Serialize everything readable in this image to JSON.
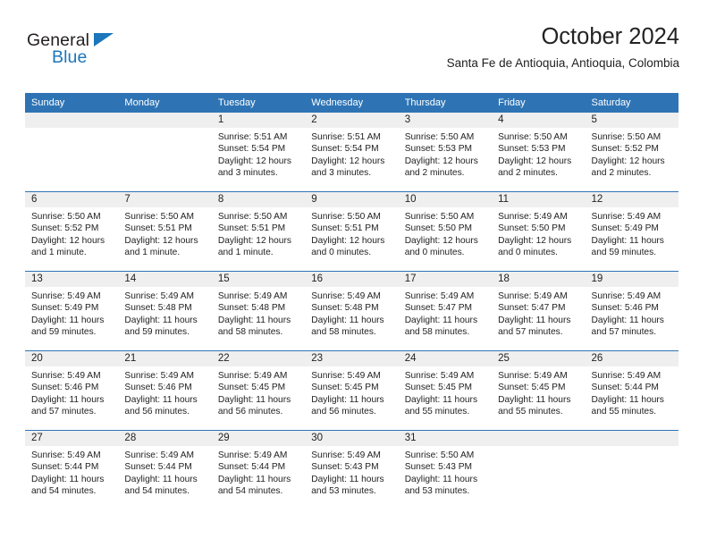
{
  "logo": {
    "word_top": "General",
    "word_bottom": "Blue",
    "triangle_color": "#1b76bc",
    "text_color": "#231f20"
  },
  "header": {
    "month_title": "October 2024",
    "location": "Santa Fe de Antioquia, Antioquia, Colombia",
    "accent_color": "#2e74b5"
  },
  "calendar": {
    "weekday_headers": [
      "Sunday",
      "Monday",
      "Tuesday",
      "Wednesday",
      "Thursday",
      "Friday",
      "Saturday"
    ],
    "header_bg": "#2e74b5",
    "header_text_color": "#ffffff",
    "daynum_bg": "#efefef",
    "weeks": [
      [
        {
          "day": "",
          "sunrise": "",
          "sunset": "",
          "daylight_line1": "",
          "daylight_line2": ""
        },
        {
          "day": "",
          "sunrise": "",
          "sunset": "",
          "daylight_line1": "",
          "daylight_line2": ""
        },
        {
          "day": "1",
          "sunrise": "Sunrise: 5:51 AM",
          "sunset": "Sunset: 5:54 PM",
          "daylight_line1": "Daylight: 12 hours",
          "daylight_line2": "and 3 minutes."
        },
        {
          "day": "2",
          "sunrise": "Sunrise: 5:51 AM",
          "sunset": "Sunset: 5:54 PM",
          "daylight_line1": "Daylight: 12 hours",
          "daylight_line2": "and 3 minutes."
        },
        {
          "day": "3",
          "sunrise": "Sunrise: 5:50 AM",
          "sunset": "Sunset: 5:53 PM",
          "daylight_line1": "Daylight: 12 hours",
          "daylight_line2": "and 2 minutes."
        },
        {
          "day": "4",
          "sunrise": "Sunrise: 5:50 AM",
          "sunset": "Sunset: 5:53 PM",
          "daylight_line1": "Daylight: 12 hours",
          "daylight_line2": "and 2 minutes."
        },
        {
          "day": "5",
          "sunrise": "Sunrise: 5:50 AM",
          "sunset": "Sunset: 5:52 PM",
          "daylight_line1": "Daylight: 12 hours",
          "daylight_line2": "and 2 minutes."
        }
      ],
      [
        {
          "day": "6",
          "sunrise": "Sunrise: 5:50 AM",
          "sunset": "Sunset: 5:52 PM",
          "daylight_line1": "Daylight: 12 hours",
          "daylight_line2": "and 1 minute."
        },
        {
          "day": "7",
          "sunrise": "Sunrise: 5:50 AM",
          "sunset": "Sunset: 5:51 PM",
          "daylight_line1": "Daylight: 12 hours",
          "daylight_line2": "and 1 minute."
        },
        {
          "day": "8",
          "sunrise": "Sunrise: 5:50 AM",
          "sunset": "Sunset: 5:51 PM",
          "daylight_line1": "Daylight: 12 hours",
          "daylight_line2": "and 1 minute."
        },
        {
          "day": "9",
          "sunrise": "Sunrise: 5:50 AM",
          "sunset": "Sunset: 5:51 PM",
          "daylight_line1": "Daylight: 12 hours",
          "daylight_line2": "and 0 minutes."
        },
        {
          "day": "10",
          "sunrise": "Sunrise: 5:50 AM",
          "sunset": "Sunset: 5:50 PM",
          "daylight_line1": "Daylight: 12 hours",
          "daylight_line2": "and 0 minutes."
        },
        {
          "day": "11",
          "sunrise": "Sunrise: 5:49 AM",
          "sunset": "Sunset: 5:50 PM",
          "daylight_line1": "Daylight: 12 hours",
          "daylight_line2": "and 0 minutes."
        },
        {
          "day": "12",
          "sunrise": "Sunrise: 5:49 AM",
          "sunset": "Sunset: 5:49 PM",
          "daylight_line1": "Daylight: 11 hours",
          "daylight_line2": "and 59 minutes."
        }
      ],
      [
        {
          "day": "13",
          "sunrise": "Sunrise: 5:49 AM",
          "sunset": "Sunset: 5:49 PM",
          "daylight_line1": "Daylight: 11 hours",
          "daylight_line2": "and 59 minutes."
        },
        {
          "day": "14",
          "sunrise": "Sunrise: 5:49 AM",
          "sunset": "Sunset: 5:48 PM",
          "daylight_line1": "Daylight: 11 hours",
          "daylight_line2": "and 59 minutes."
        },
        {
          "day": "15",
          "sunrise": "Sunrise: 5:49 AM",
          "sunset": "Sunset: 5:48 PM",
          "daylight_line1": "Daylight: 11 hours",
          "daylight_line2": "and 58 minutes."
        },
        {
          "day": "16",
          "sunrise": "Sunrise: 5:49 AM",
          "sunset": "Sunset: 5:48 PM",
          "daylight_line1": "Daylight: 11 hours",
          "daylight_line2": "and 58 minutes."
        },
        {
          "day": "17",
          "sunrise": "Sunrise: 5:49 AM",
          "sunset": "Sunset: 5:47 PM",
          "daylight_line1": "Daylight: 11 hours",
          "daylight_line2": "and 58 minutes."
        },
        {
          "day": "18",
          "sunrise": "Sunrise: 5:49 AM",
          "sunset": "Sunset: 5:47 PM",
          "daylight_line1": "Daylight: 11 hours",
          "daylight_line2": "and 57 minutes."
        },
        {
          "day": "19",
          "sunrise": "Sunrise: 5:49 AM",
          "sunset": "Sunset: 5:46 PM",
          "daylight_line1": "Daylight: 11 hours",
          "daylight_line2": "and 57 minutes."
        }
      ],
      [
        {
          "day": "20",
          "sunrise": "Sunrise: 5:49 AM",
          "sunset": "Sunset: 5:46 PM",
          "daylight_line1": "Daylight: 11 hours",
          "daylight_line2": "and 57 minutes."
        },
        {
          "day": "21",
          "sunrise": "Sunrise: 5:49 AM",
          "sunset": "Sunset: 5:46 PM",
          "daylight_line1": "Daylight: 11 hours",
          "daylight_line2": "and 56 minutes."
        },
        {
          "day": "22",
          "sunrise": "Sunrise: 5:49 AM",
          "sunset": "Sunset: 5:45 PM",
          "daylight_line1": "Daylight: 11 hours",
          "daylight_line2": "and 56 minutes."
        },
        {
          "day": "23",
          "sunrise": "Sunrise: 5:49 AM",
          "sunset": "Sunset: 5:45 PM",
          "daylight_line1": "Daylight: 11 hours",
          "daylight_line2": "and 56 minutes."
        },
        {
          "day": "24",
          "sunrise": "Sunrise: 5:49 AM",
          "sunset": "Sunset: 5:45 PM",
          "daylight_line1": "Daylight: 11 hours",
          "daylight_line2": "and 55 minutes."
        },
        {
          "day": "25",
          "sunrise": "Sunrise: 5:49 AM",
          "sunset": "Sunset: 5:45 PM",
          "daylight_line1": "Daylight: 11 hours",
          "daylight_line2": "and 55 minutes."
        },
        {
          "day": "26",
          "sunrise": "Sunrise: 5:49 AM",
          "sunset": "Sunset: 5:44 PM",
          "daylight_line1": "Daylight: 11 hours",
          "daylight_line2": "and 55 minutes."
        }
      ],
      [
        {
          "day": "27",
          "sunrise": "Sunrise: 5:49 AM",
          "sunset": "Sunset: 5:44 PM",
          "daylight_line1": "Daylight: 11 hours",
          "daylight_line2": "and 54 minutes."
        },
        {
          "day": "28",
          "sunrise": "Sunrise: 5:49 AM",
          "sunset": "Sunset: 5:44 PM",
          "daylight_line1": "Daylight: 11 hours",
          "daylight_line2": "and 54 minutes."
        },
        {
          "day": "29",
          "sunrise": "Sunrise: 5:49 AM",
          "sunset": "Sunset: 5:44 PM",
          "daylight_line1": "Daylight: 11 hours",
          "daylight_line2": "and 54 minutes."
        },
        {
          "day": "30",
          "sunrise": "Sunrise: 5:49 AM",
          "sunset": "Sunset: 5:43 PM",
          "daylight_line1": "Daylight: 11 hours",
          "daylight_line2": "and 53 minutes."
        },
        {
          "day": "31",
          "sunrise": "Sunrise: 5:50 AM",
          "sunset": "Sunset: 5:43 PM",
          "daylight_line1": "Daylight: 11 hours",
          "daylight_line2": "and 53 minutes."
        },
        {
          "day": "",
          "sunrise": "",
          "sunset": "",
          "daylight_line1": "",
          "daylight_line2": ""
        },
        {
          "day": "",
          "sunrise": "",
          "sunset": "",
          "daylight_line1": "",
          "daylight_line2": ""
        }
      ]
    ]
  }
}
